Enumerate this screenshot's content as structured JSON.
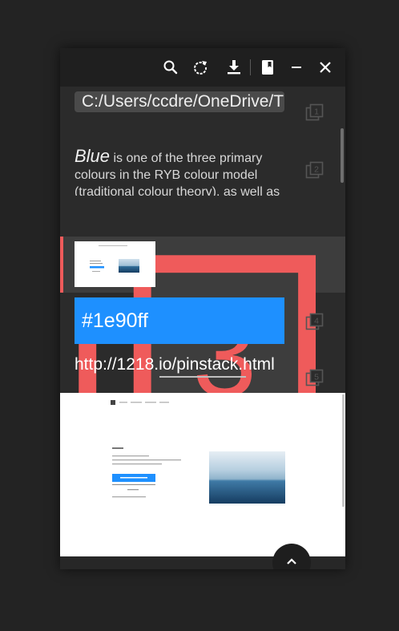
{
  "toolbar": {
    "icons": [
      "search-icon",
      "refresh-icon",
      "download-icon",
      "book-icon",
      "minimize-icon",
      "close-icon"
    ]
  },
  "clips": [
    {
      "index": "1",
      "type": "path",
      "text": "C:/Users/ccdre/OneDrive/T"
    },
    {
      "index": "2",
      "type": "text",
      "emphasis": "Blue",
      "text": " is one of the three primary colours in the RYB colour model (traditional colour theory), as well as in"
    },
    {
      "index": "3",
      "type": "image",
      "selected": true
    },
    {
      "index": "4",
      "type": "color",
      "text": "#1e90ff"
    },
    {
      "index": "5",
      "type": "url",
      "text": "http://1218.io/pinstack.html"
    }
  ],
  "colors": {
    "accent_red": "#ef5b5b",
    "swatch": "#1e90ff",
    "toolbar_bg": "#1f1f1f",
    "list_bg": "#2b2b2b",
    "selected_bg": "#3d3d3d"
  },
  "preview": {
    "type": "webpage-screenshot"
  },
  "fab": {
    "icon": "chevron-up-icon"
  }
}
